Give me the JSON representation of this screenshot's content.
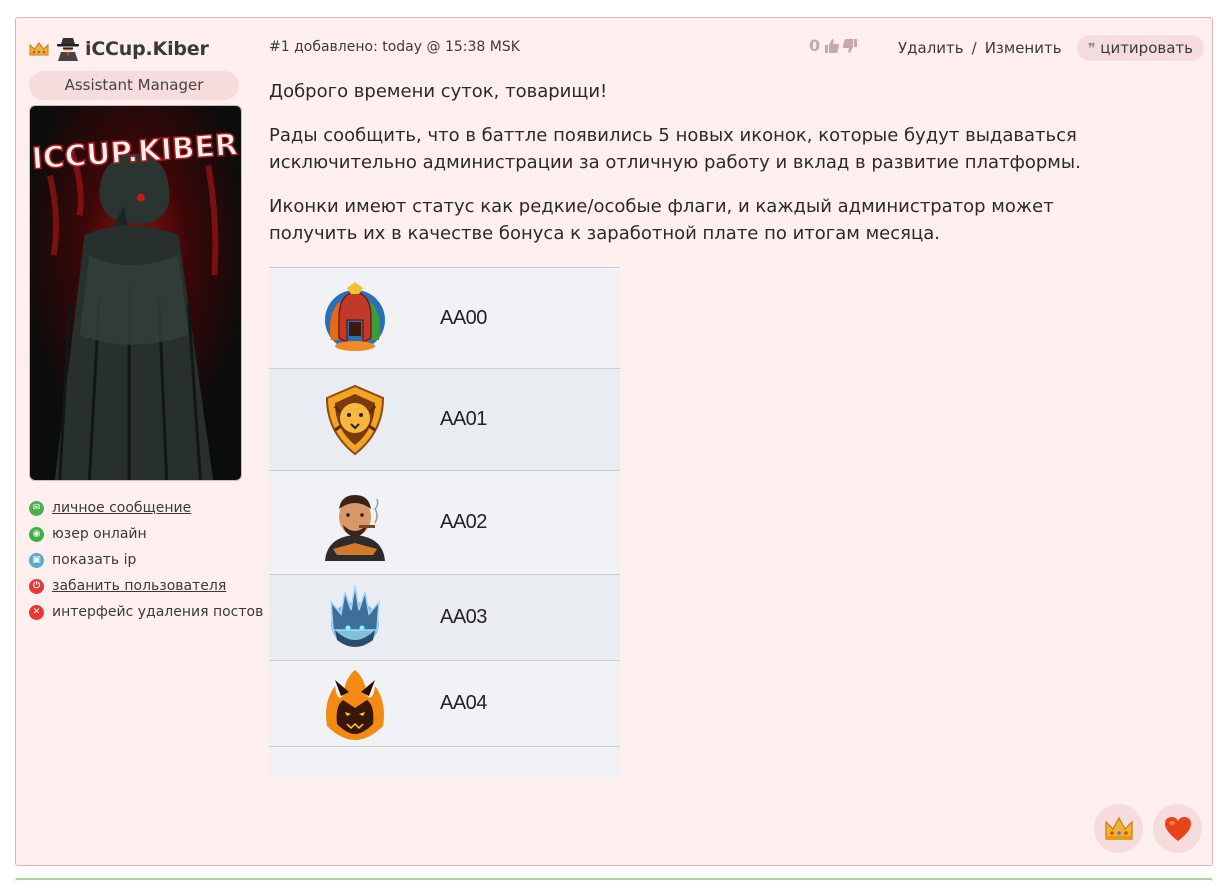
{
  "user": {
    "name": "iCCup.Kiber",
    "rank": "Assistant Manager",
    "avatar_text": "ICCUP.KIBER",
    "links": [
      {
        "label": "личное сообщение",
        "icon": "mail-icon",
        "color": "#4caf50",
        "link": true
      },
      {
        "label": "юзер онлайн",
        "icon": "online-icon",
        "color": "#3cb043",
        "link": false
      },
      {
        "label": "показать ip",
        "icon": "computer-icon",
        "color": "#5aa9c9",
        "link": false
      },
      {
        "label": "забанить пользователя",
        "icon": "power-icon",
        "color": "#e53935",
        "link": true
      },
      {
        "label": "интерфейс удаления постов",
        "icon": "delete-icon",
        "color": "#e53935",
        "link": false
      }
    ]
  },
  "header": {
    "meta": "#1 добавлено: today @ 15:38 MSK",
    "votes": "0",
    "delete_label": "Удалить",
    "separator": "/",
    "edit_label": "Изменить",
    "quote_label": "цитировать"
  },
  "body": {
    "paragraphs": [
      "Доброго времени суток, товарищи!",
      "Рады сообщить, что в баттле появились 5 новых иконок, которые будут выдаваться исключительно администрации за отличную работу и вклад в развитие платформы.",
      "Иконки имеют статус как редкие/особые флаги, и каждый администратор может получить их в качестве бонуса к заработной плате по итогам месяца."
    ]
  },
  "badges": [
    {
      "code": "AA00",
      "icon": "spartan-helmet-icon"
    },
    {
      "code": "AA01",
      "icon": "lion-shield-icon"
    },
    {
      "code": "AA02",
      "icon": "cigar-man-icon"
    },
    {
      "code": "AA03",
      "icon": "ice-crown-icon"
    },
    {
      "code": "AA04",
      "icon": "fire-demon-icon"
    }
  ],
  "reactions": [
    {
      "icon": "crown-reaction-icon"
    },
    {
      "icon": "heart-reaction-icon"
    }
  ],
  "colors": {
    "post_bg": "#fff0ef",
    "post_border": "#e3b3b3",
    "pill_bg": "#f6dcdc",
    "table_bg": "#f1f2f5",
    "heart": "#e8431a",
    "crown": "#f2b233"
  }
}
